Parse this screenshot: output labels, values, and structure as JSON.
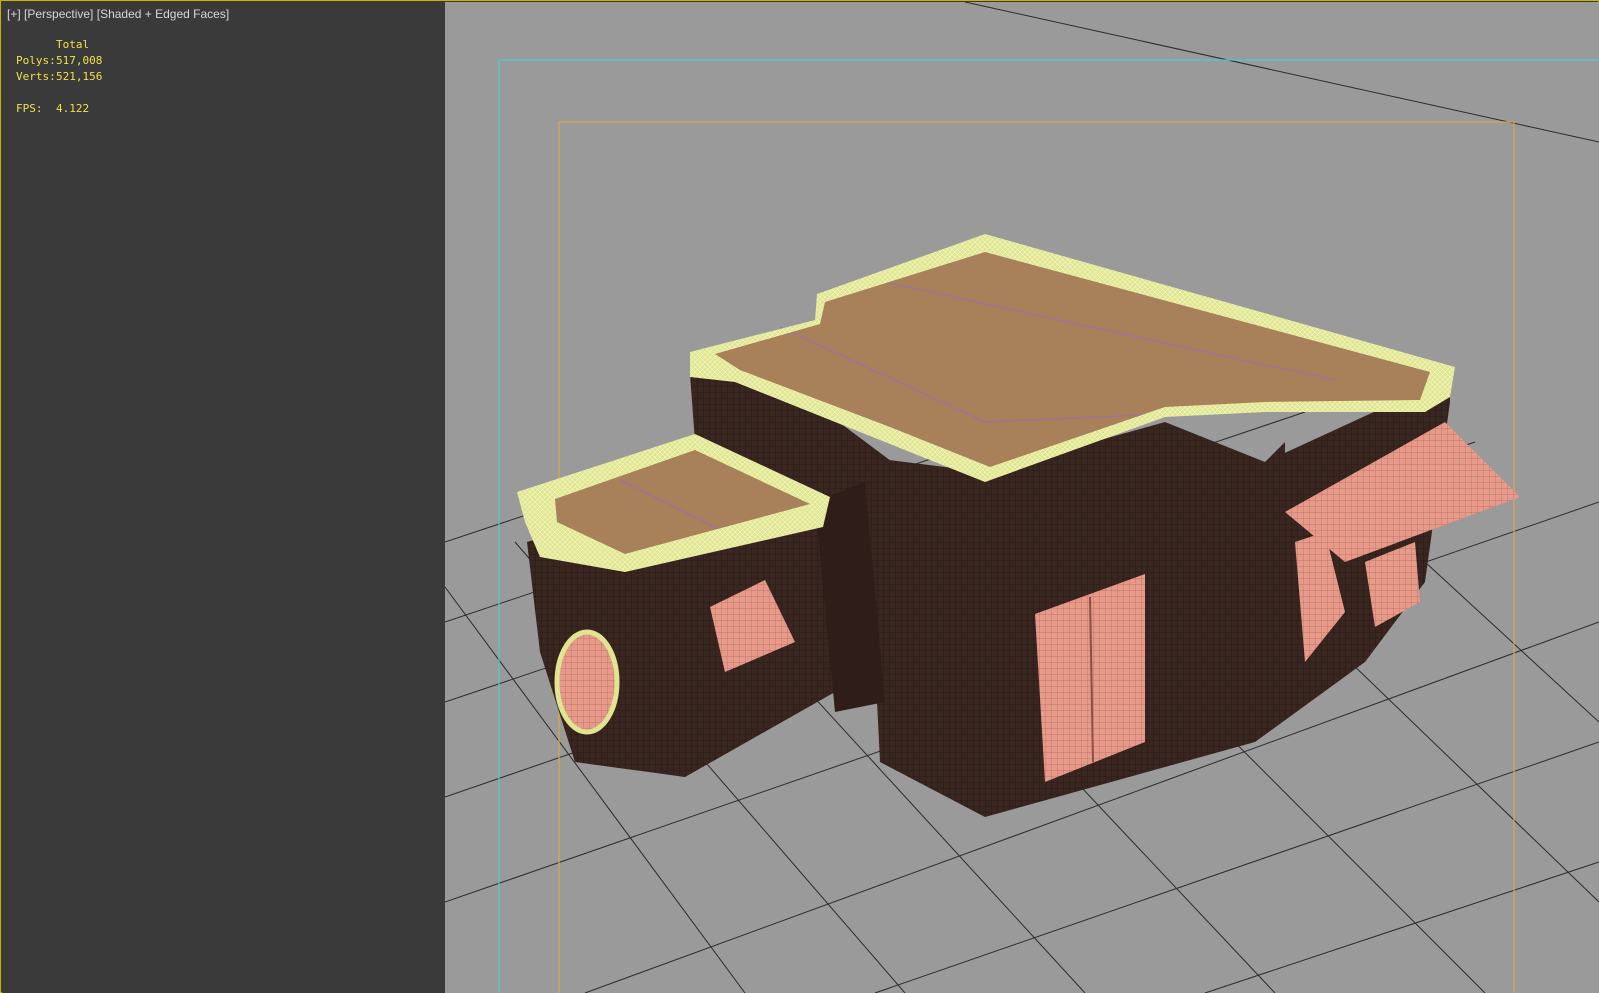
{
  "viewport": {
    "label_plus": "[+]",
    "label_view": "[Perspective]",
    "label_shading": "[Shaded + Edged Faces]"
  },
  "stats": {
    "header": "Total",
    "polys_label": "Polys:",
    "polys_value": "517,008",
    "verts_label": "Verts:",
    "verts_value": "521,156",
    "fps_label": "FPS:",
    "fps_value": "4.122"
  },
  "colors": {
    "viewport_bg": "#9a9a9a",
    "panel_bg": "#3a3a3a",
    "stat_text": "#f2e04a",
    "active_border": "#c8b400",
    "safe_frame_outer": "#4fc9d8",
    "safe_frame_inner": "#d8a84a",
    "wireframe_highlight": "#f0f4a0",
    "wall": "#3a2620",
    "roof": "#a8805a",
    "trim": "#e89a8a"
  }
}
